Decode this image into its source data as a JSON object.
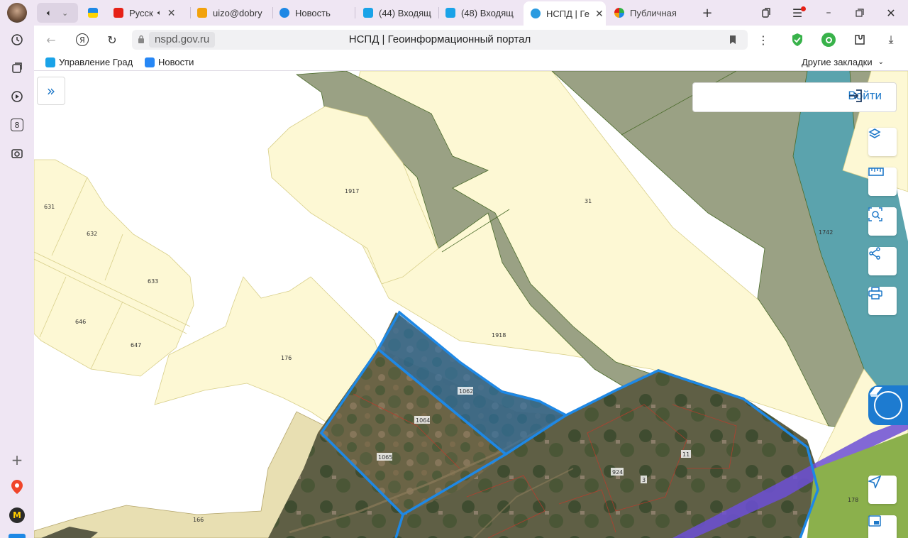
{
  "browser": {
    "tabs": [
      {
        "label": "",
        "icon": "speaker-icon"
      },
      {
        "label": "",
        "icon": "yandex-icon"
      },
      {
        "label": "Русск",
        "icon": "youtube-icon"
      },
      {
        "label": "uizo@dobry",
        "icon": "mail-icon"
      },
      {
        "label": "Новость",
        "icon": "at-icon"
      },
      {
        "label": "(44) Входящ",
        "icon": "mail-icon"
      },
      {
        "label": "(48) Входящ",
        "icon": "mail-icon"
      },
      {
        "label": "НСПД | Ге",
        "icon": "nspd-icon"
      },
      {
        "label": "Публичная",
        "icon": "pkk-icon"
      }
    ],
    "url": "nspd.gov.ru",
    "page_title": "НСПД | Геоинформационный портал",
    "bookmarks": [
      {
        "label": "Управление Град"
      },
      {
        "label": "Новости"
      }
    ],
    "other_bookmarks": "Другие закладки",
    "colors": {
      "accent": "#1e78c8",
      "tabbar": "#efe6f3"
    }
  },
  "left_rail": {
    "icons": [
      "history-icon",
      "collections-icon",
      "video-icon",
      "badge-8-icon",
      "screenshot-icon",
      "add-icon",
      "maps-icon",
      "zen-icon"
    ],
    "badge": "8"
  },
  "map": {
    "login_label": "Войти",
    "parcels": [
      "631",
      "632",
      "633",
      "646",
      "647",
      "176",
      "1917",
      "31",
      "1918",
      "1742",
      "1062",
      "1064",
      "1065",
      "924",
      "3",
      "11",
      "166",
      "178"
    ],
    "tools": [
      "layers-icon",
      "ruler-icon",
      "search-area-icon",
      "share-icon",
      "print-icon"
    ],
    "colors": {
      "parcel_fill": "#fdf8d4",
      "forest": "#9aa184",
      "selection": "#1e88e5",
      "water": "#5ba3ad"
    }
  }
}
